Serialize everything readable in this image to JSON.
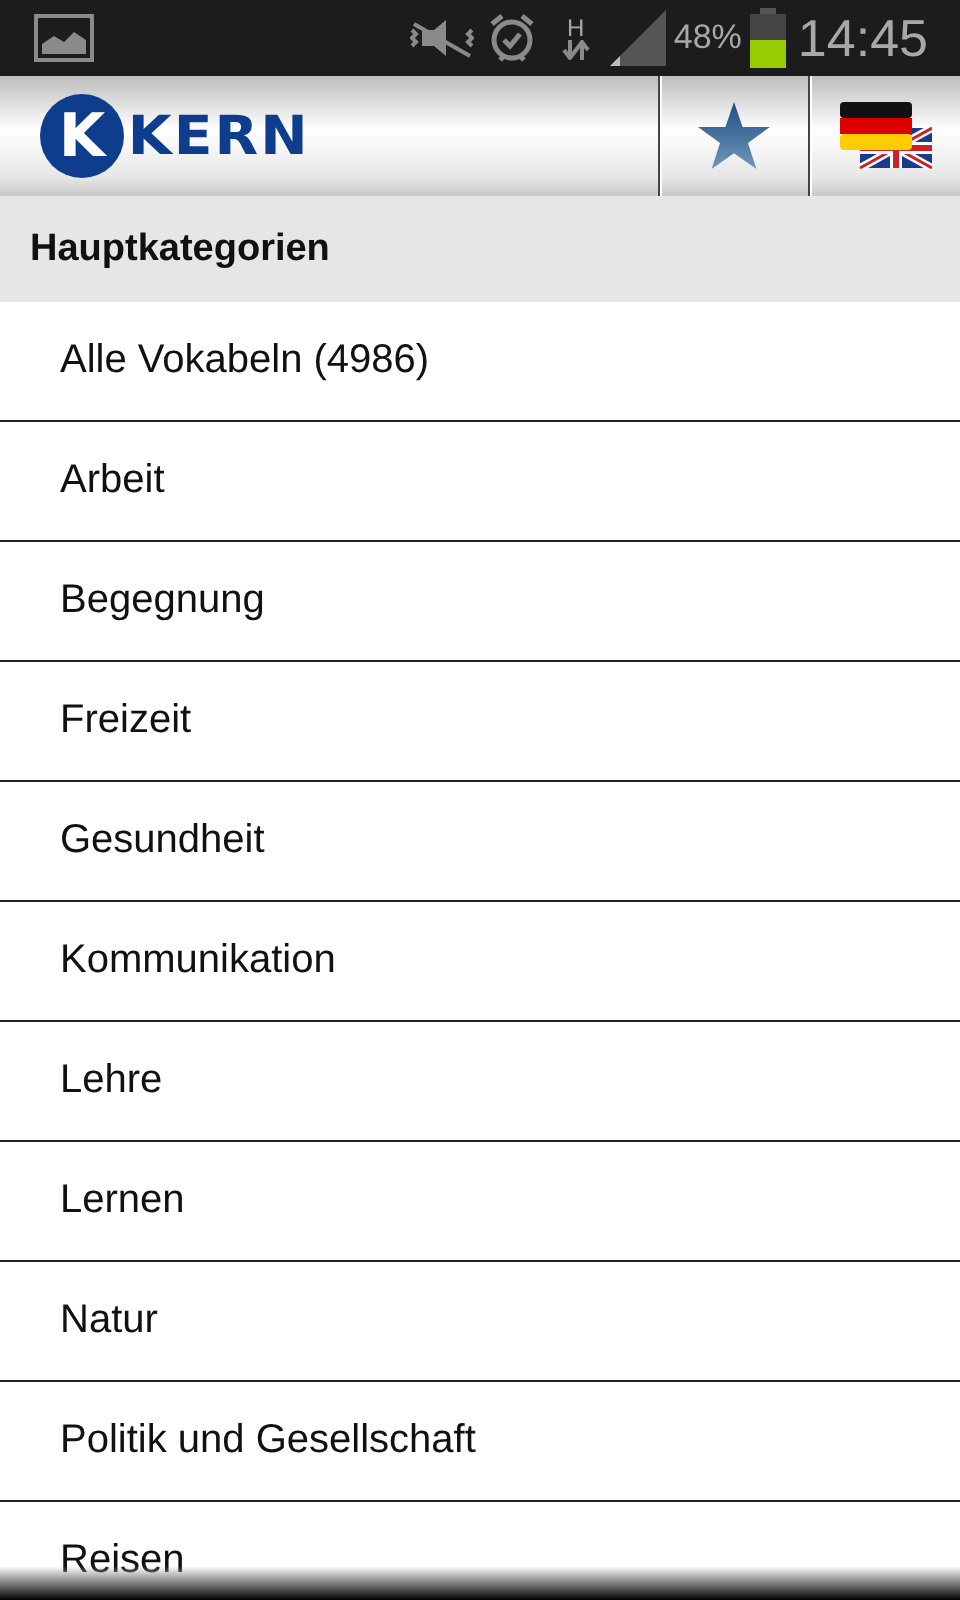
{
  "status_bar": {
    "network": "H",
    "battery": "48%",
    "time": "14:45"
  },
  "app_bar": {
    "logo_letter": "K",
    "logo_text": "KERN"
  },
  "section": {
    "title": "Hauptkategorien"
  },
  "categories": [
    "Alle Vokabeln (4986)",
    "Arbeit",
    "Begegnung",
    "Freizeit",
    "Gesundheit",
    "Kommunikation",
    "Lehre",
    "Lernen",
    "Natur",
    "Politik und Gesellschaft",
    "Reisen"
  ]
}
